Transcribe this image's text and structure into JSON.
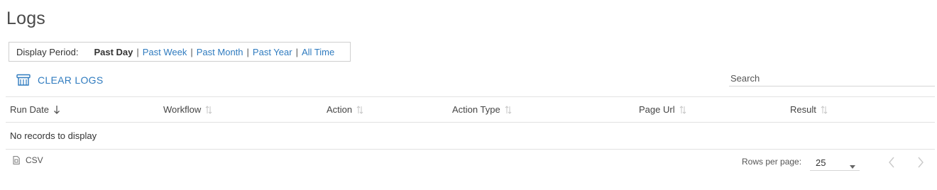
{
  "page": {
    "title": "Logs"
  },
  "display_period": {
    "label": "Display Period:",
    "options": [
      {
        "label": "Past Day",
        "active": true
      },
      {
        "label": "Past Week",
        "active": false
      },
      {
        "label": "Past Month",
        "active": false
      },
      {
        "label": "Past Year",
        "active": false
      },
      {
        "label": "All Time",
        "active": false
      }
    ],
    "separator": "|"
  },
  "toolbar": {
    "clear_logs_label": "CLEAR LOGS",
    "clear_logs_icon": "clear-logs-icon",
    "search_placeholder": "Search",
    "search_value": ""
  },
  "table": {
    "columns": [
      {
        "label": "Run Date",
        "sort": "descending",
        "icon": "sort-down-arrow-icon"
      },
      {
        "label": "Workflow",
        "sort": "none",
        "icon": "sort-icon"
      },
      {
        "label": "Action",
        "sort": "none",
        "icon": "sort-icon"
      },
      {
        "label": "Action Type",
        "sort": "none",
        "icon": "sort-icon"
      },
      {
        "label": "Page Url",
        "sort": "none",
        "icon": "sort-icon"
      },
      {
        "label": "Result",
        "sort": "none",
        "icon": "sort-icon"
      }
    ],
    "empty_message": "No records to display"
  },
  "footer": {
    "csv_label": "CSV",
    "csv_icon": "file-icon",
    "rows_per_page_label": "Rows per page:",
    "rows_per_page_value": "25",
    "prev_icon": "chevron-left-icon",
    "next_icon": "chevron-right-icon"
  },
  "colors": {
    "link": "#2f7bbf",
    "border": "#e2e2e2",
    "muted_icon": "#c9c9c9"
  }
}
